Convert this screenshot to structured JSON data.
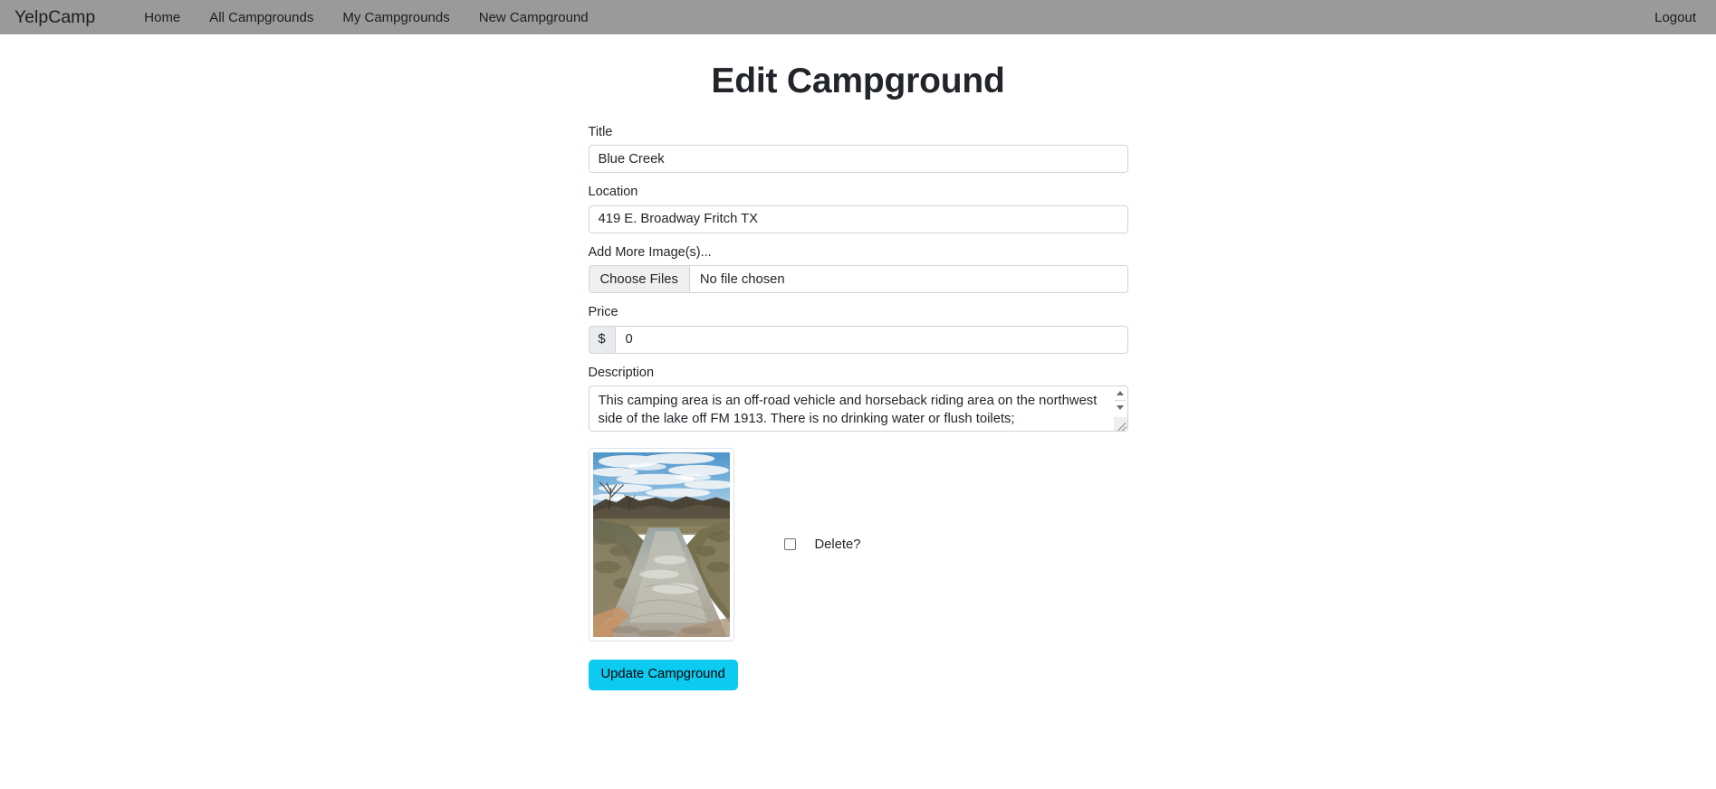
{
  "navbar": {
    "brand": "YelpCamp",
    "links": [
      {
        "label": "Home",
        "name": "nav-link-home"
      },
      {
        "label": "All Campgrounds",
        "name": "nav-link-all-campgrounds"
      },
      {
        "label": "My Campgrounds",
        "name": "nav-link-my-campgrounds"
      },
      {
        "label": "New Campground",
        "name": "nav-link-new-campground"
      }
    ],
    "logout": "Logout",
    "background_color": "#9a9a9a"
  },
  "page": {
    "title": "Edit Campground"
  },
  "form": {
    "title_field": {
      "label": "Title",
      "value": "Blue Creek"
    },
    "location_field": {
      "label": "Location",
      "value": "419 E. Broadway Fritch TX"
    },
    "images_field": {
      "label": "Add More Image(s)...",
      "button_label": "Choose Files",
      "file_status": "No file chosen"
    },
    "price_field": {
      "label": "Price",
      "prefix": "$",
      "value": "0"
    },
    "description_field": {
      "label": "Description",
      "value": "This camping area is an off-road vehicle and horseback riding area on the northwest side of the lake off FM 1913. There is no drinking water or flush toilets;"
    },
    "existing_image": {
      "delete_label": "Delete?",
      "delete_checked": false,
      "alt": "creek running through a sandy off-road trail with bare trees and cloudy blue sky"
    },
    "submit_button": {
      "label": "Update Campground",
      "color": "#0dcaf0"
    }
  }
}
